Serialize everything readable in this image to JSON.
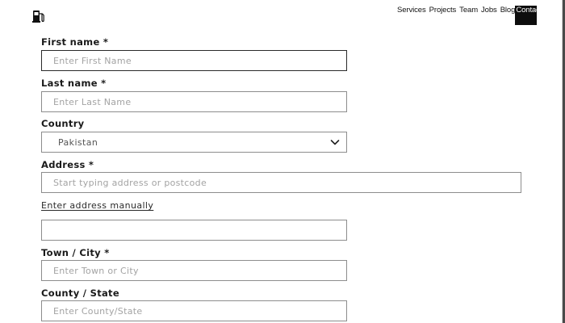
{
  "header": {
    "logo_icon": "fuel-pump-icon",
    "nav": [
      {
        "label": "Services"
      },
      {
        "label": "Projects"
      },
      {
        "label": "Team"
      },
      {
        "label": "Jobs"
      },
      {
        "label": "Blog"
      },
      {
        "label": "Contact"
      }
    ]
  },
  "form": {
    "first_name": {
      "label": "First name *",
      "placeholder": "Enter First Name",
      "value": ""
    },
    "last_name": {
      "label": "Last name *",
      "placeholder": "Enter Last Name",
      "value": ""
    },
    "country": {
      "label": "Country",
      "selected": "Pakistan",
      "icon": "chevron-down-icon"
    },
    "address": {
      "label": "Address *",
      "placeholder": "Start typing address or postcode",
      "value": ""
    },
    "manual_link": "Enter address manually",
    "address_manual": {
      "value": "",
      "placeholder": ""
    },
    "town_city": {
      "label": "Town / City *",
      "placeholder": "Enter Town or City",
      "value": ""
    },
    "county_state": {
      "label": "County / State",
      "placeholder": "Enter County/State",
      "value": ""
    }
  },
  "colors": {
    "border": "#8d8d8d",
    "focused_border": "#2a2a2a",
    "placeholder": "#a3a3a3",
    "contact_bg": "#0d0d0d"
  }
}
